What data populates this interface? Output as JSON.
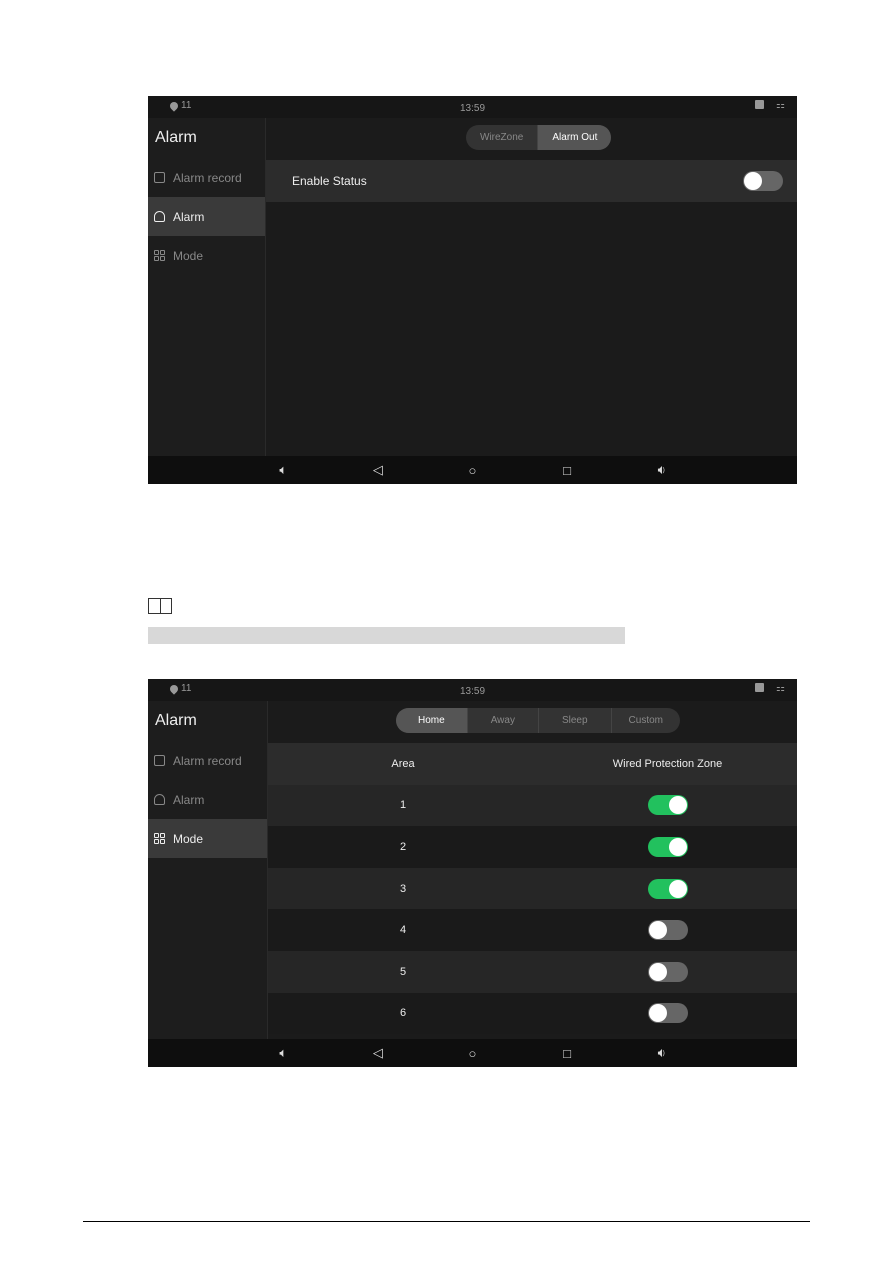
{
  "screen1": {
    "status": {
      "signal": "11",
      "time": "13:59"
    },
    "sidebar": {
      "title": "Alarm",
      "items": [
        {
          "label": "Alarm record",
          "icon": "record-icon",
          "active": false
        },
        {
          "label": "Alarm",
          "icon": "alarm-icon",
          "active": true
        },
        {
          "label": "Mode",
          "icon": "grid-icon",
          "active": false
        }
      ]
    },
    "tabs": [
      {
        "label": "WireZone",
        "active": false
      },
      {
        "label": "Alarm Out",
        "active": true
      }
    ],
    "enable_status": {
      "label": "Enable Status",
      "on": false
    }
  },
  "screen2": {
    "status": {
      "signal": "11",
      "time": "13:59"
    },
    "sidebar": {
      "title": "Alarm",
      "items": [
        {
          "label": "Alarm record",
          "icon": "record-icon",
          "active": false
        },
        {
          "label": "Alarm",
          "icon": "alarm-icon",
          "active": false
        },
        {
          "label": "Mode",
          "icon": "grid-icon",
          "active": true
        }
      ]
    },
    "tabs": [
      {
        "label": "Home",
        "active": true
      },
      {
        "label": "Away",
        "active": false
      },
      {
        "label": "Sleep",
        "active": false
      },
      {
        "label": "Custom",
        "active": false
      }
    ],
    "table": {
      "headers": [
        "Area",
        "Wired Protection Zone"
      ],
      "rows": [
        {
          "area": "1",
          "on": true
        },
        {
          "area": "2",
          "on": true
        },
        {
          "area": "3",
          "on": true
        },
        {
          "area": "4",
          "on": false
        },
        {
          "area": "5",
          "on": false
        },
        {
          "area": "6",
          "on": false
        }
      ]
    }
  },
  "navbar": [
    "volume-down-icon",
    "back-icon",
    "home-icon",
    "recents-icon",
    "volume-up-icon"
  ],
  "colors": {
    "toggle_on": "#22c15e",
    "toggle_off": "#666666",
    "screen_bg": "#1b1b1b"
  }
}
